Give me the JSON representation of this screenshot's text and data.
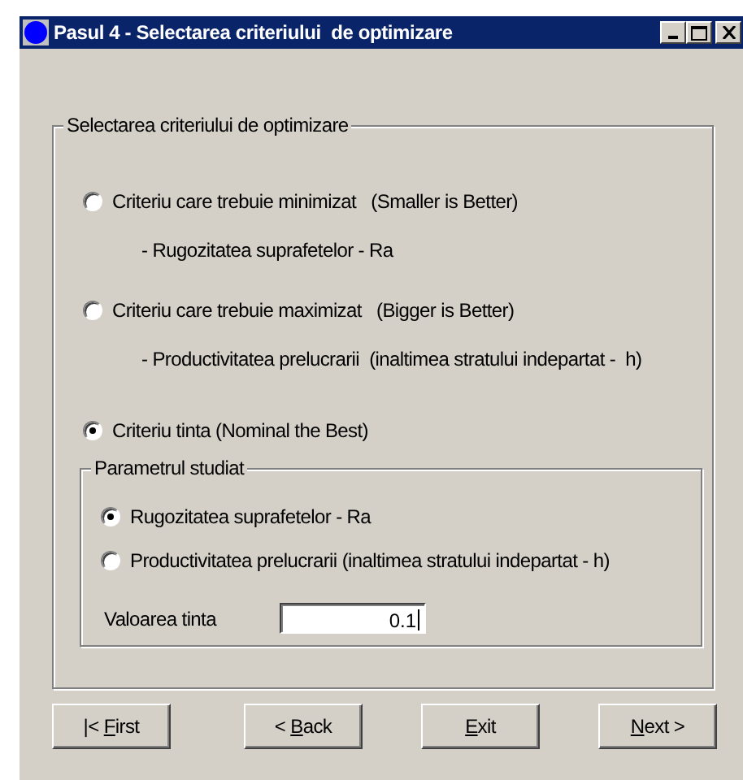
{
  "window": {
    "title": "Pasul 4 - Selectarea criteriului  de optimizare"
  },
  "criteria_group": {
    "title": "Selectarea criteriului de optimizare",
    "options": [
      {
        "label": "Criteriu care trebuie minimizat   (Smaller is Better)",
        "detail": "- Rugozitatea suprafetelor - Ra",
        "selected": false
      },
      {
        "label": "Criteriu care trebuie maximizat   (Bigger is Better)",
        "detail": "- Productivitatea prelucrarii  (inaltimea stratului indepartat -  h)",
        "selected": false
      },
      {
        "label": "Criteriu tinta (Nominal the Best)",
        "selected": true
      }
    ]
  },
  "parameter_group": {
    "title": "Parametrul studiat",
    "options": [
      {
        "label": "Rugozitatea suprafetelor - Ra",
        "selected": true
      },
      {
        "label": "Productivitatea prelucrarii (inaltimea stratului indepartat - h)",
        "selected": false
      }
    ],
    "target": {
      "label": "Valoarea tinta",
      "value": "0.1"
    }
  },
  "buttons": [
    {
      "before": "|< ",
      "key": "F",
      "after": "irst"
    },
    {
      "before": "< ",
      "key": "B",
      "after": "ack"
    },
    {
      "key": "E",
      "after": "xit"
    },
    {
      "key": "N",
      "after": "ext >"
    }
  ]
}
